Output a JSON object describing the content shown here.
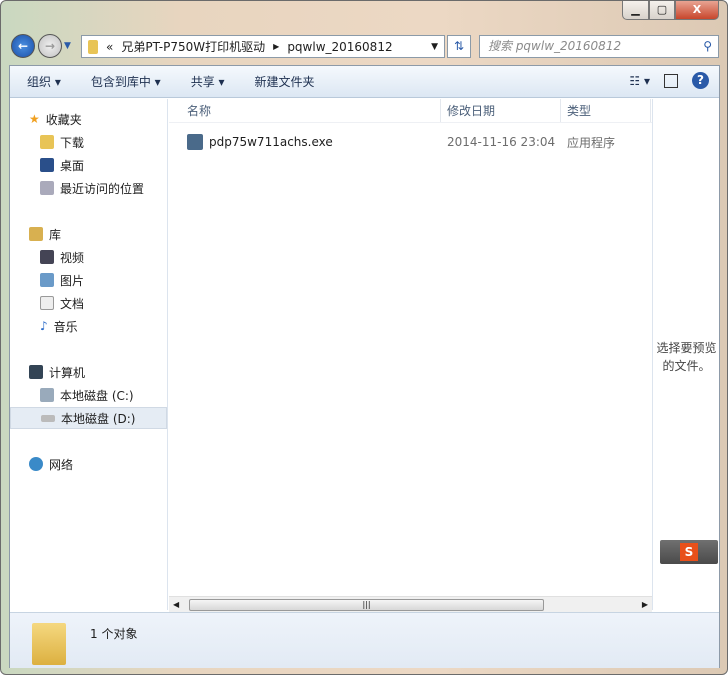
{
  "window": {
    "controls": {
      "minimize": "▁",
      "maximize": "▢",
      "close": "X"
    }
  },
  "address": {
    "overflow": "«",
    "crumbs": [
      "兄弟PT-P750W打印机驱动",
      "pqwlw_20160812"
    ]
  },
  "search": {
    "placeholder": "搜索 pqwlw_20160812"
  },
  "toolbar": {
    "organize": "组织 ▾",
    "include": "包含到库中 ▾",
    "share": "共享 ▾",
    "new_folder": "新建文件夹"
  },
  "sidebar": {
    "favorites": "收藏夹",
    "fav_items": [
      "下载",
      "桌面",
      "最近访问的位置"
    ],
    "libraries": "库",
    "lib_items": [
      "视频",
      "图片",
      "文档",
      "音乐"
    ],
    "computer": "计算机",
    "drives": [
      "本地磁盘 (C:)",
      "本地磁盘 (D:)"
    ],
    "network": "网络"
  },
  "columns": {
    "name": "名称",
    "date": "修改日期",
    "type": "类型"
  },
  "files": [
    {
      "name": "pdp75w711achs.exe",
      "date": "2014-11-16 23:04",
      "type": "应用程序"
    }
  ],
  "preview": {
    "text": "选择要预览的文件。"
  },
  "status": {
    "count": "1 个对象"
  }
}
